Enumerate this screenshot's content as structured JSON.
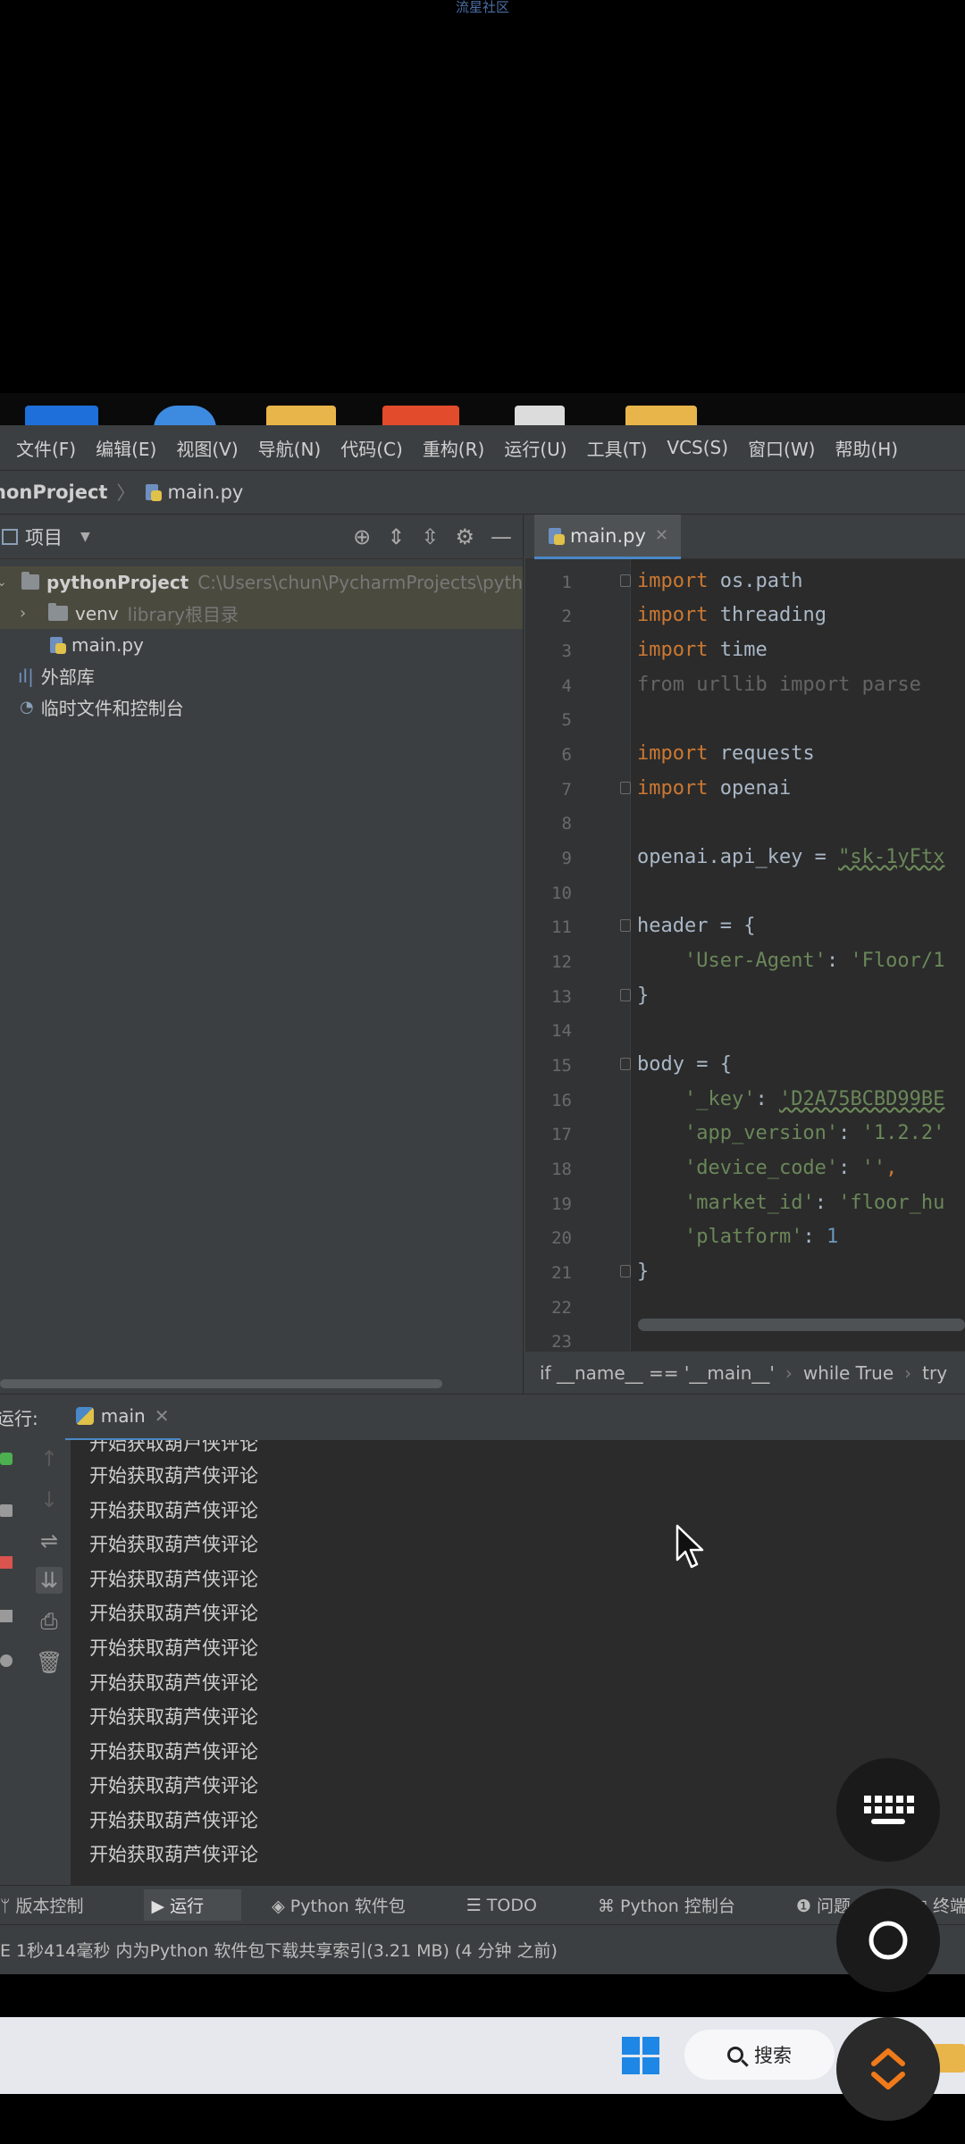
{
  "watermark": "流星社区",
  "menu": [
    "文件(F)",
    "编辑(E)",
    "视图(V)",
    "导航(N)",
    "代码(C)",
    "重构(R)",
    "运行(U)",
    "工具(T)",
    "VCS(S)",
    "窗口(W)",
    "帮助(H)"
  ],
  "breadcrumb": {
    "project": "honProject",
    "file": "main.py"
  },
  "project_panel": {
    "title": "项目",
    "root": {
      "name": "pythonProject",
      "path": "C:\\Users\\chun\\PycharmProjects\\pyth"
    },
    "venv": {
      "name": "venv",
      "hint": "library根目录"
    },
    "file": "main.py",
    "external": "外部库",
    "scratches": "临时文件和控制台"
  },
  "editor": {
    "tab": "main.py",
    "lines": [
      "1",
      "2",
      "3",
      "4",
      "5",
      "6",
      "7",
      "8",
      "9",
      "10",
      "11",
      "12",
      "13",
      "14",
      "15",
      "16",
      "17",
      "18",
      "19",
      "20",
      "21",
      "22",
      "23"
    ],
    "breadcrumbs": [
      "if __name__ == '__main__'",
      "while True",
      "try"
    ]
  },
  "code": {
    "l1_kw": "import",
    "l1_rest": " os.path",
    "l2_kw": "import",
    "l2_rest": " threading",
    "l3_kw": "import",
    "l3_rest": " time",
    "l4": "from urllib import parse",
    "l6_kw": "import",
    "l6_rest": " requests",
    "l7_kw": "import",
    "l7_rest": " openai",
    "l9_a": "openai.api_key = ",
    "l9_s": "\"sk-1yFtx",
    "l11": "header = {",
    "l12_s1": "'User-Agent'",
    "l12_c": ": ",
    "l12_s2": "'Floor/1",
    "l13": "}",
    "l15": "body = {",
    "l16_s1": "'_key'",
    "l16_c": ": ",
    "l16_s2": "'D2A75BCBD99BE",
    "l17_s1": "'app_version'",
    "l17_c": ": ",
    "l17_s2": "'1.2.2'",
    "l18_s1": "'device_code'",
    "l18_c": ": ",
    "l18_s2": "''",
    "l18_e": ",",
    "l19_s1": "'market_id'",
    "l19_c": ": ",
    "l19_s2": "'floor_hu",
    "l20_s1": "'platform'",
    "l20_c": ": ",
    "l20_n": "1",
    "l21": "}"
  },
  "run": {
    "label": "运行:",
    "tab": "main",
    "lines": [
      "开始获取葫芦侠评论",
      "开始获取葫芦侠评论",
      "开始获取葫芦侠评论",
      "开始获取葫芦侠评论",
      "开始获取葫芦侠评论",
      "开始获取葫芦侠评论",
      "开始获取葫芦侠评论",
      "开始获取葫芦侠评论",
      "开始获取葫芦侠评论",
      "开始获取葫芦侠评论",
      "开始获取葫芦侠评论",
      "开始获取葫芦侠评论",
      "开始获取葫芦侠评论",
      "开始获取葫芦侠评论"
    ]
  },
  "bottom_tabs": [
    "版本控制",
    "运行",
    "Python 软件包",
    "TODO",
    "Python 控制台",
    "问题",
    "终端"
  ],
  "status": "E 1秒414毫秒 内为Python 软件包下载共享索引(3.21 MB) (4 分钟 之前)",
  "taskbar": {
    "search": "搜索"
  },
  "colors": {
    "accent": "#4a88c7",
    "keyword": "#cc7832",
    "string": "#6a8759",
    "number": "#6897bb"
  }
}
